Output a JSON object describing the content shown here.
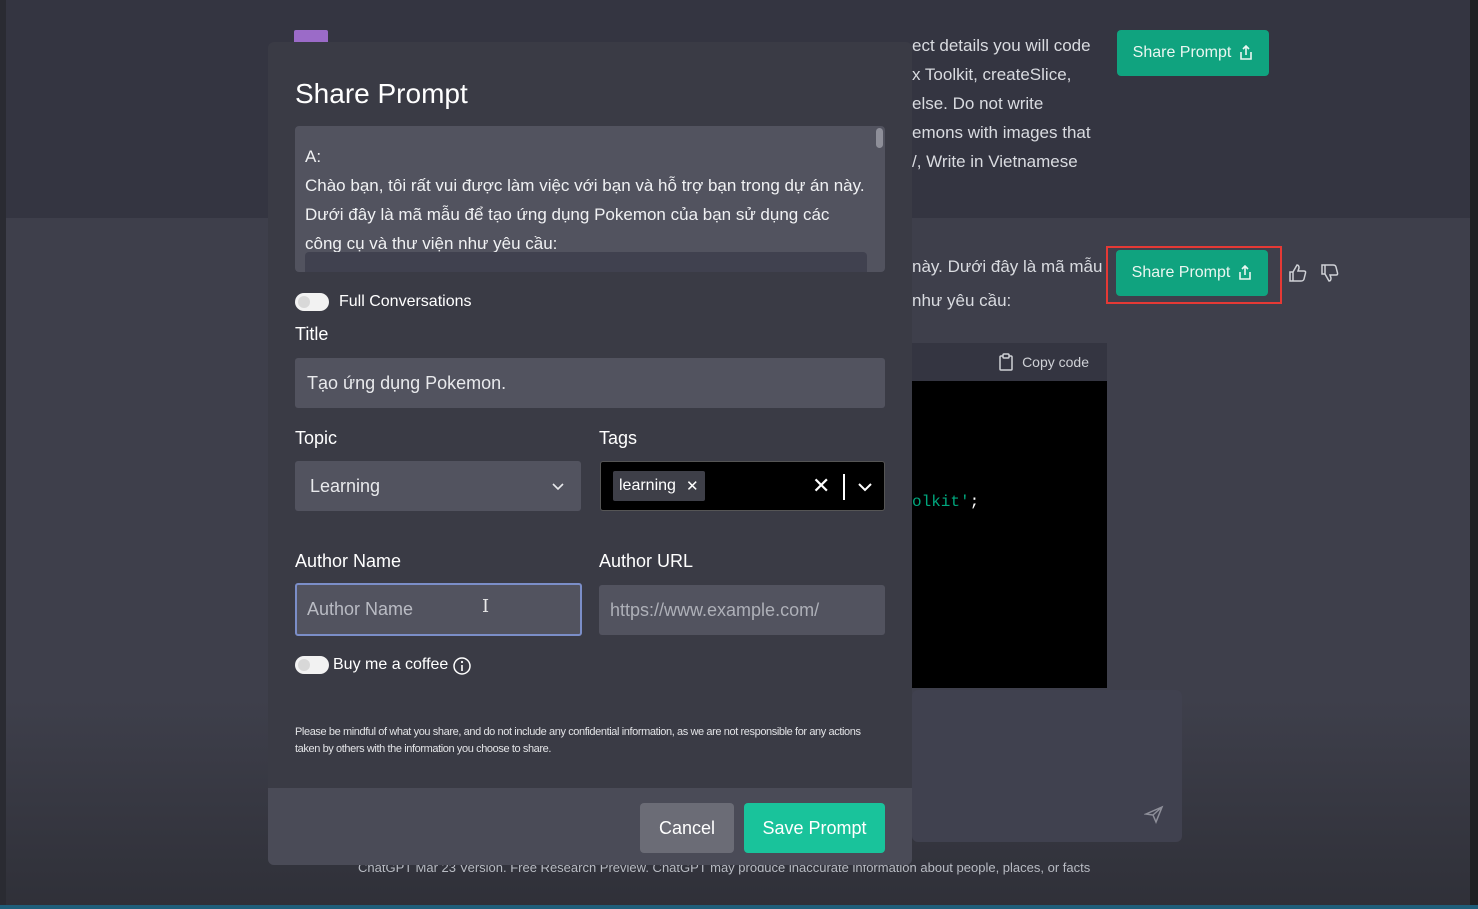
{
  "background": {
    "user_message_lines": [
      "ect details you will code",
      "x Toolkit, createSlice,",
      "else. Do not write",
      "emons with images that",
      "/, Write in Vietnamese"
    ],
    "assistant_message_lines": [
      "này. Dưới đây là mã mẫu",
      "như yêu cầu:"
    ],
    "share_prompt_label": "Share Prompt",
    "copy_code_label": "Copy code",
    "code_line_green": "olkit'",
    "code_line_white": ";",
    "footer_note": "ChatGPT Mar 23 Version. Free Research Preview. ChatGPT may produce inaccurate information about people, places, or facts"
  },
  "modal": {
    "title": "Share Prompt",
    "preview": {
      "speaker": "A:",
      "text": "Chào bạn, tôi rất vui được làm việc với bạn và hỗ trợ bạn trong dự án này. Dưới đây là mã mẫu để tạo ứng dụng Pokemon của bạn sử dụng các công cụ và thư viện như yêu cầu:"
    },
    "full_conversations_label": "Full Conversations",
    "title_label": "Title",
    "title_value": "Tạo ứng dụng Pokemon.",
    "topic_label": "Topic",
    "topic_value": "Learning",
    "tags_label": "Tags",
    "tags": [
      "learning"
    ],
    "author_name_label": "Author Name",
    "author_name_placeholder": "Author Name",
    "author_url_label": "Author URL",
    "author_url_placeholder": "https://www.example.com/",
    "buy_coffee_label": "Buy me a coffee",
    "disclaimer": "Please be mindful of what you share, and do not include any confidential information, as we are not responsible for any actions taken by others with the information you choose to share.",
    "cancel_label": "Cancel",
    "save_label": "Save Prompt"
  },
  "colors": {
    "share_button": "#10a37f",
    "save_button": "#19c39b",
    "highlight_box": "#e53935",
    "focus_ring": "#7b8ec8"
  }
}
